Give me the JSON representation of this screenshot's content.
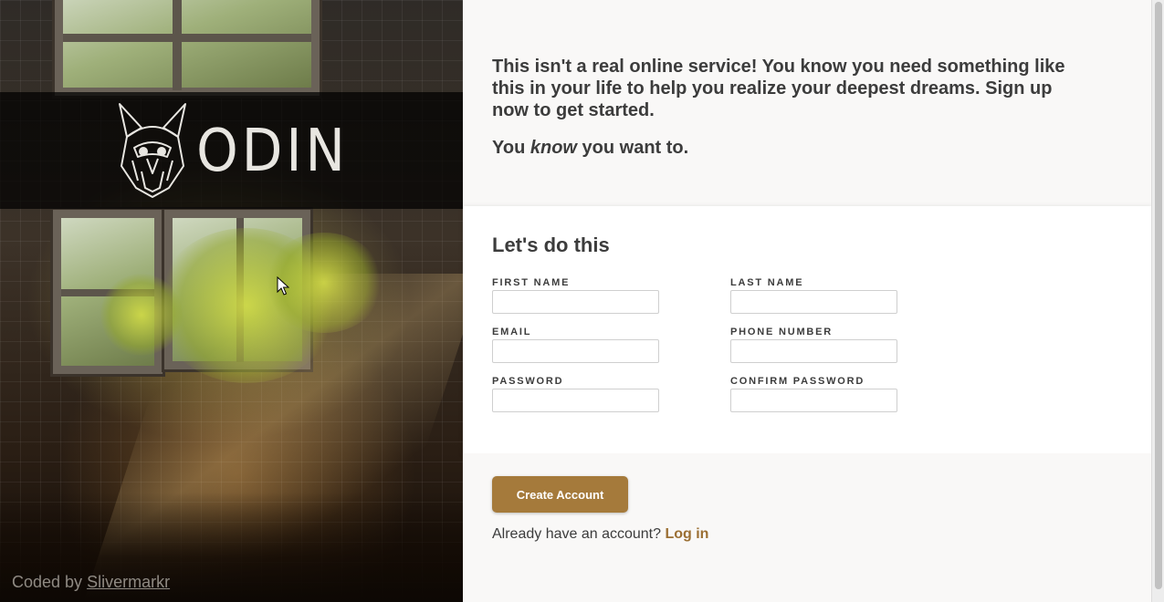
{
  "hero": {
    "logo_text": "ODIN",
    "credit_prefix": "Coded by",
    "credit_link": "Slivermarkr"
  },
  "intro": {
    "paragraph1": "This isn't a real online service! You know you need something like this in your life to help you realize your deepest dreams. Sign up now to get started.",
    "paragraph2_before": "You ",
    "paragraph2_emphasis": "know",
    "paragraph2_after": " you want to."
  },
  "form": {
    "title": "Let's do this",
    "fields": [
      {
        "label": "FIRST NAME",
        "value": ""
      },
      {
        "label": "LAST NAME",
        "value": ""
      },
      {
        "label": "EMAIL",
        "value": ""
      },
      {
        "label": "PHONE NUMBER",
        "value": ""
      },
      {
        "label": "PASSWORD",
        "value": ""
      },
      {
        "label": "CONFIRM PASSWORD",
        "value": ""
      }
    ]
  },
  "action": {
    "create_button": "Create Account",
    "login_prompt": "Already have an account?",
    "login_link": "Log in"
  },
  "colors": {
    "accent": "#a57a3b",
    "link": "#9b6f33",
    "text": "#3c3c3c",
    "panel_bg": "#f9f8f7"
  },
  "icons": {
    "logo": "viking-helmet-icon",
    "cursor": "mouse-pointer-icon"
  }
}
